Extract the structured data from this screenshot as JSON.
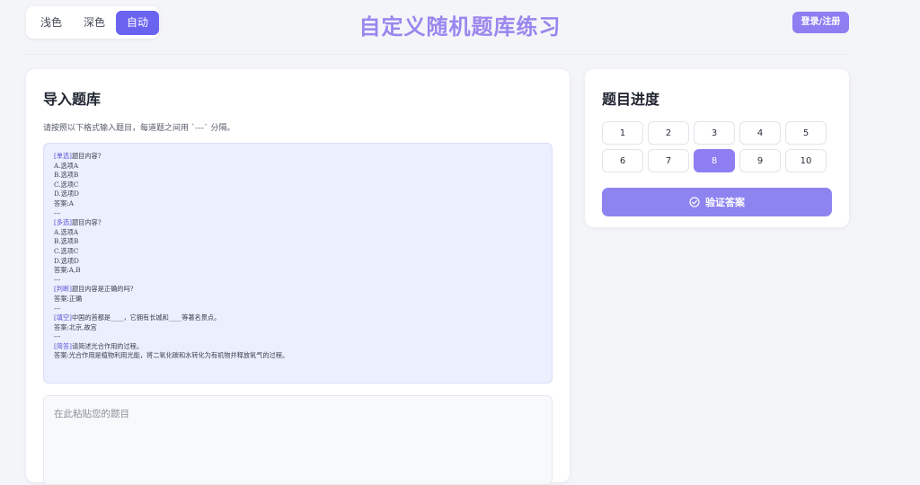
{
  "header": {
    "theme_options": [
      "浅色",
      "深色",
      "自动"
    ],
    "active_theme": "自动",
    "title": "自定义随机题库练习",
    "login_label": "登录/注册"
  },
  "import_panel": {
    "title": "导入题库",
    "hint": "请按照以下格式输入题目，每道题之间用 `---` 分隔。",
    "example_lines": [
      {
        "tag": "[单选]",
        "text": "题目内容?"
      },
      {
        "tag": "",
        "text": "A.选项A"
      },
      {
        "tag": "",
        "text": "B.选项B"
      },
      {
        "tag": "",
        "text": "C.选项C"
      },
      {
        "tag": "",
        "text": "D.选项D"
      },
      {
        "tag": "",
        "text": "答案:A"
      },
      {
        "tag": "",
        "text": "---"
      },
      {
        "tag": "[多选]",
        "text": "题目内容?"
      },
      {
        "tag": "",
        "text": "A.选项A"
      },
      {
        "tag": "",
        "text": "B.选项B"
      },
      {
        "tag": "",
        "text": "C.选项C"
      },
      {
        "tag": "",
        "text": "D.选项D"
      },
      {
        "tag": "",
        "text": "答案:A,B"
      },
      {
        "tag": "",
        "text": "---"
      },
      {
        "tag": "[判断]",
        "text": "题目内容是正确的吗?"
      },
      {
        "tag": "",
        "text": "答案:正确"
      },
      {
        "tag": "",
        "text": "---"
      },
      {
        "tag": "[填空]",
        "text": "中国的首都是____，它拥有长城和____等著名景点。"
      },
      {
        "tag": "",
        "text": "答案:北京,故宫"
      },
      {
        "tag": "",
        "text": "---"
      },
      {
        "tag": "[简答]",
        "text": "请简述光合作用的过程。"
      },
      {
        "tag": "",
        "text": "答案:光合作用是植物利用光能，将二氧化碳和水转化为有机物并释放氧气的过程。"
      }
    ],
    "paste_placeholder": "在此粘贴您的题目"
  },
  "progress_panel": {
    "title": "题目进度",
    "questions": [
      "1",
      "2",
      "3",
      "4",
      "5",
      "6",
      "7",
      "8",
      "9",
      "10"
    ],
    "current": "8",
    "verify_label": "验证答案"
  }
}
